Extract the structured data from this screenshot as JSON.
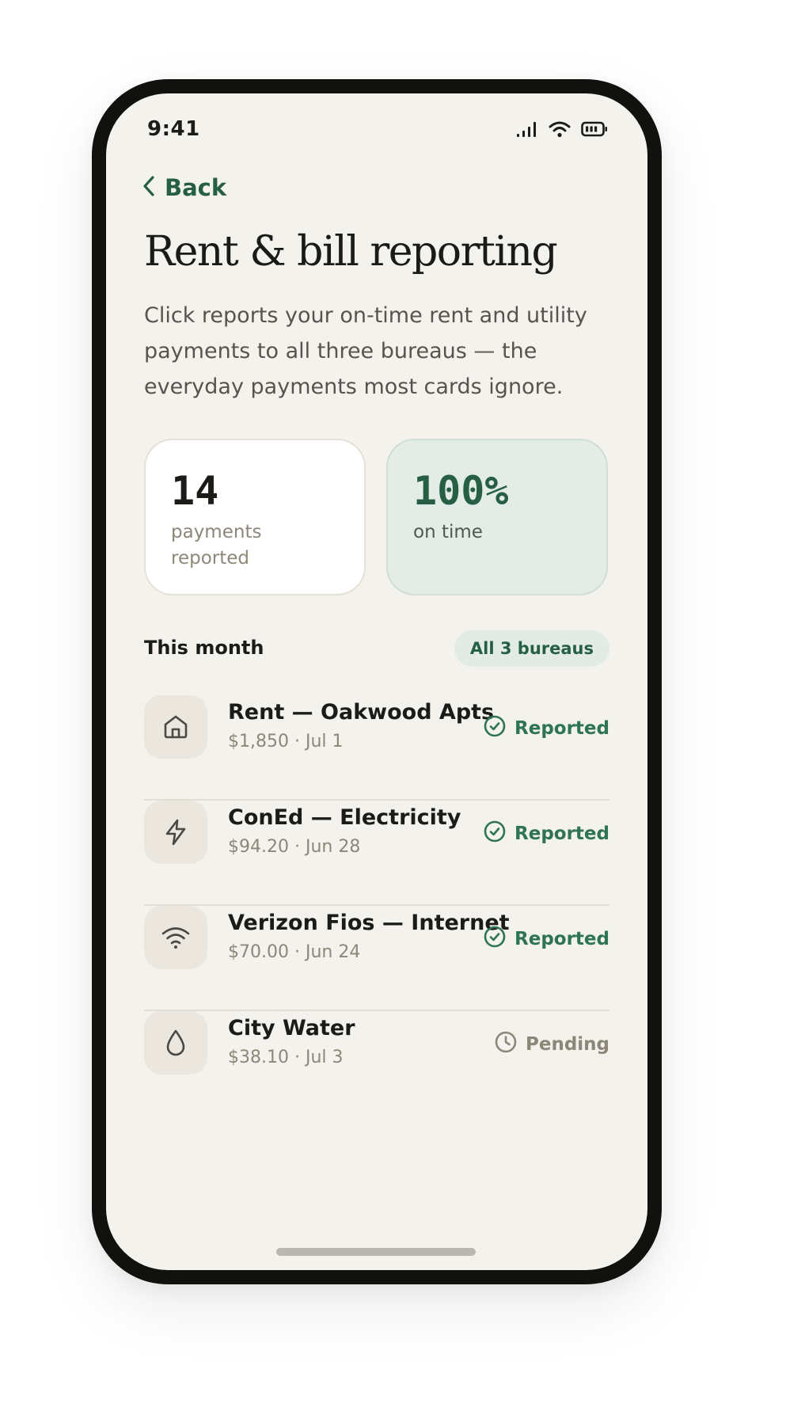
{
  "status_bar": {
    "time": "9:41",
    "icons": [
      "signal-icon",
      "wifi-icon",
      "battery-icon"
    ]
  },
  "nav": {
    "back_label": "Back"
  },
  "page": {
    "title": "Rent & bill reporting",
    "description": "Click reports your on-time rent and utility payments to all three bureaus — the everyday payments most cards ignore."
  },
  "stats": [
    {
      "value": "14",
      "label": "payments reported"
    },
    {
      "value": "100%",
      "label": "on time"
    }
  ],
  "section": {
    "title": "This month",
    "badge": "All 3 bureaus"
  },
  "payments": [
    {
      "icon": "home-icon",
      "name": "Rent — Oakwood Apts",
      "meta": "$1,850 · Jul 1",
      "status": "Reported",
      "status_icon": "check-circle-icon"
    },
    {
      "icon": "lightning-icon",
      "name": "ConEd — Electricity",
      "meta": "$94.20 · Jun 28",
      "status": "Reported",
      "status_icon": "check-circle-icon"
    },
    {
      "icon": "wifi-icon",
      "name": "Verizon Fios — Internet",
      "meta": "$70.00 · Jun 24",
      "status": "Reported",
      "status_icon": "check-circle-icon"
    },
    {
      "icon": "water-drop-icon",
      "name": "City Water",
      "meta": "$38.10 · Jul 3",
      "status": "Pending",
      "status_icon": "clock-icon"
    }
  ],
  "colors": {
    "accent": "#275f45",
    "reported": "#2e7354",
    "pending": "#8c8778",
    "background": "#f4f2ed",
    "stat_green": "#e3ece6"
  }
}
